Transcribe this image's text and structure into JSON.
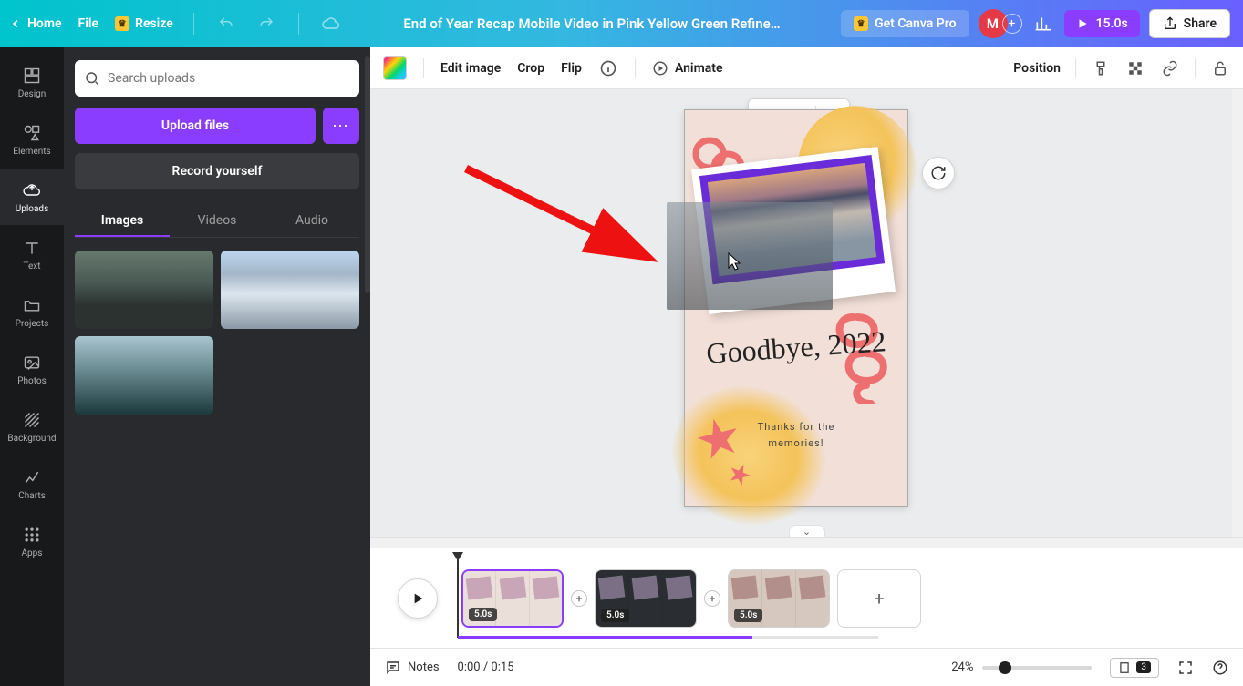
{
  "header": {
    "home": "Home",
    "file": "File",
    "resize": "Resize",
    "title": "End of Year Recap Mobile Video in Pink Yellow Green Refine…",
    "get_pro": "Get Canva Pro",
    "avatar_letter": "M",
    "play_duration": "15.0s",
    "share": "Share"
  },
  "rail": {
    "design": "Design",
    "elements": "Elements",
    "uploads": "Uploads",
    "text": "Text",
    "projects": "Projects",
    "photos": "Photos",
    "background": "Background",
    "charts": "Charts",
    "apps": "Apps"
  },
  "panel": {
    "search_placeholder": "Search uploads",
    "upload_btn": "Upload files",
    "record_btn": "Record yourself",
    "tabs": {
      "images": "Images",
      "videos": "Videos",
      "audio": "Audio"
    }
  },
  "toolbar2": {
    "edit_image": "Edit image",
    "crop": "Crop",
    "flip": "Flip",
    "animate": "Animate",
    "position": "Position"
  },
  "canvas": {
    "headline": "Goodbye, 2022",
    "subline1": "Thanks for the",
    "subline2": "memories!"
  },
  "timeline": {
    "clip_durations": [
      "5.0s",
      "5.0s",
      "5.0s"
    ]
  },
  "footer": {
    "notes": "Notes",
    "time": "0:00 / 0:15",
    "zoom_pct": "24%",
    "page_index": "3"
  }
}
